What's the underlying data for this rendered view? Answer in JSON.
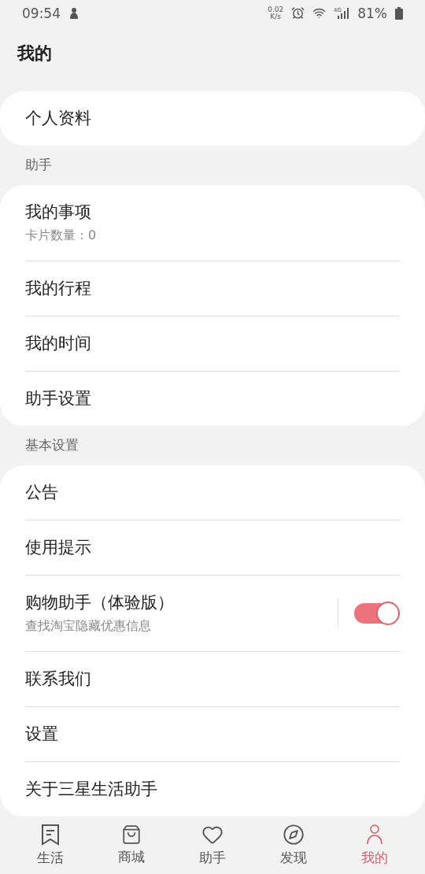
{
  "status_bar": {
    "time": "09:54",
    "speed_value": "0.02",
    "speed_unit": "K/s",
    "network": "4G",
    "battery": "81%"
  },
  "title": "我的",
  "sections": [
    {
      "items": [
        {
          "label": "个人资料",
          "kind": "plain"
        }
      ]
    },
    {
      "header": "助手",
      "items": [
        {
          "label": "我的事项",
          "subtitle": "卡片数量：0",
          "kind": "plain"
        },
        {
          "label": "我的行程",
          "kind": "plain"
        },
        {
          "label": "我的时间",
          "kind": "plain"
        },
        {
          "label": "助手设置",
          "kind": "plain"
        }
      ]
    },
    {
      "header": "基本设置",
      "items": [
        {
          "label": "公告",
          "kind": "plain"
        },
        {
          "label": "使用提示",
          "kind": "plain"
        },
        {
          "label": "购物助手（体验版）",
          "subtitle": "查找淘宝隐藏优惠信息",
          "kind": "toggle",
          "on": true
        },
        {
          "label": "联系我们",
          "kind": "plain"
        },
        {
          "label": "设置",
          "kind": "plain"
        },
        {
          "label": "关于三星生活助手",
          "kind": "plain"
        }
      ]
    }
  ],
  "nav": [
    {
      "label": "生活",
      "selected": false
    },
    {
      "label": "商城",
      "selected": false
    },
    {
      "label": "助手",
      "selected": false
    },
    {
      "label": "发现",
      "selected": false
    },
    {
      "label": "我的",
      "selected": true
    }
  ]
}
